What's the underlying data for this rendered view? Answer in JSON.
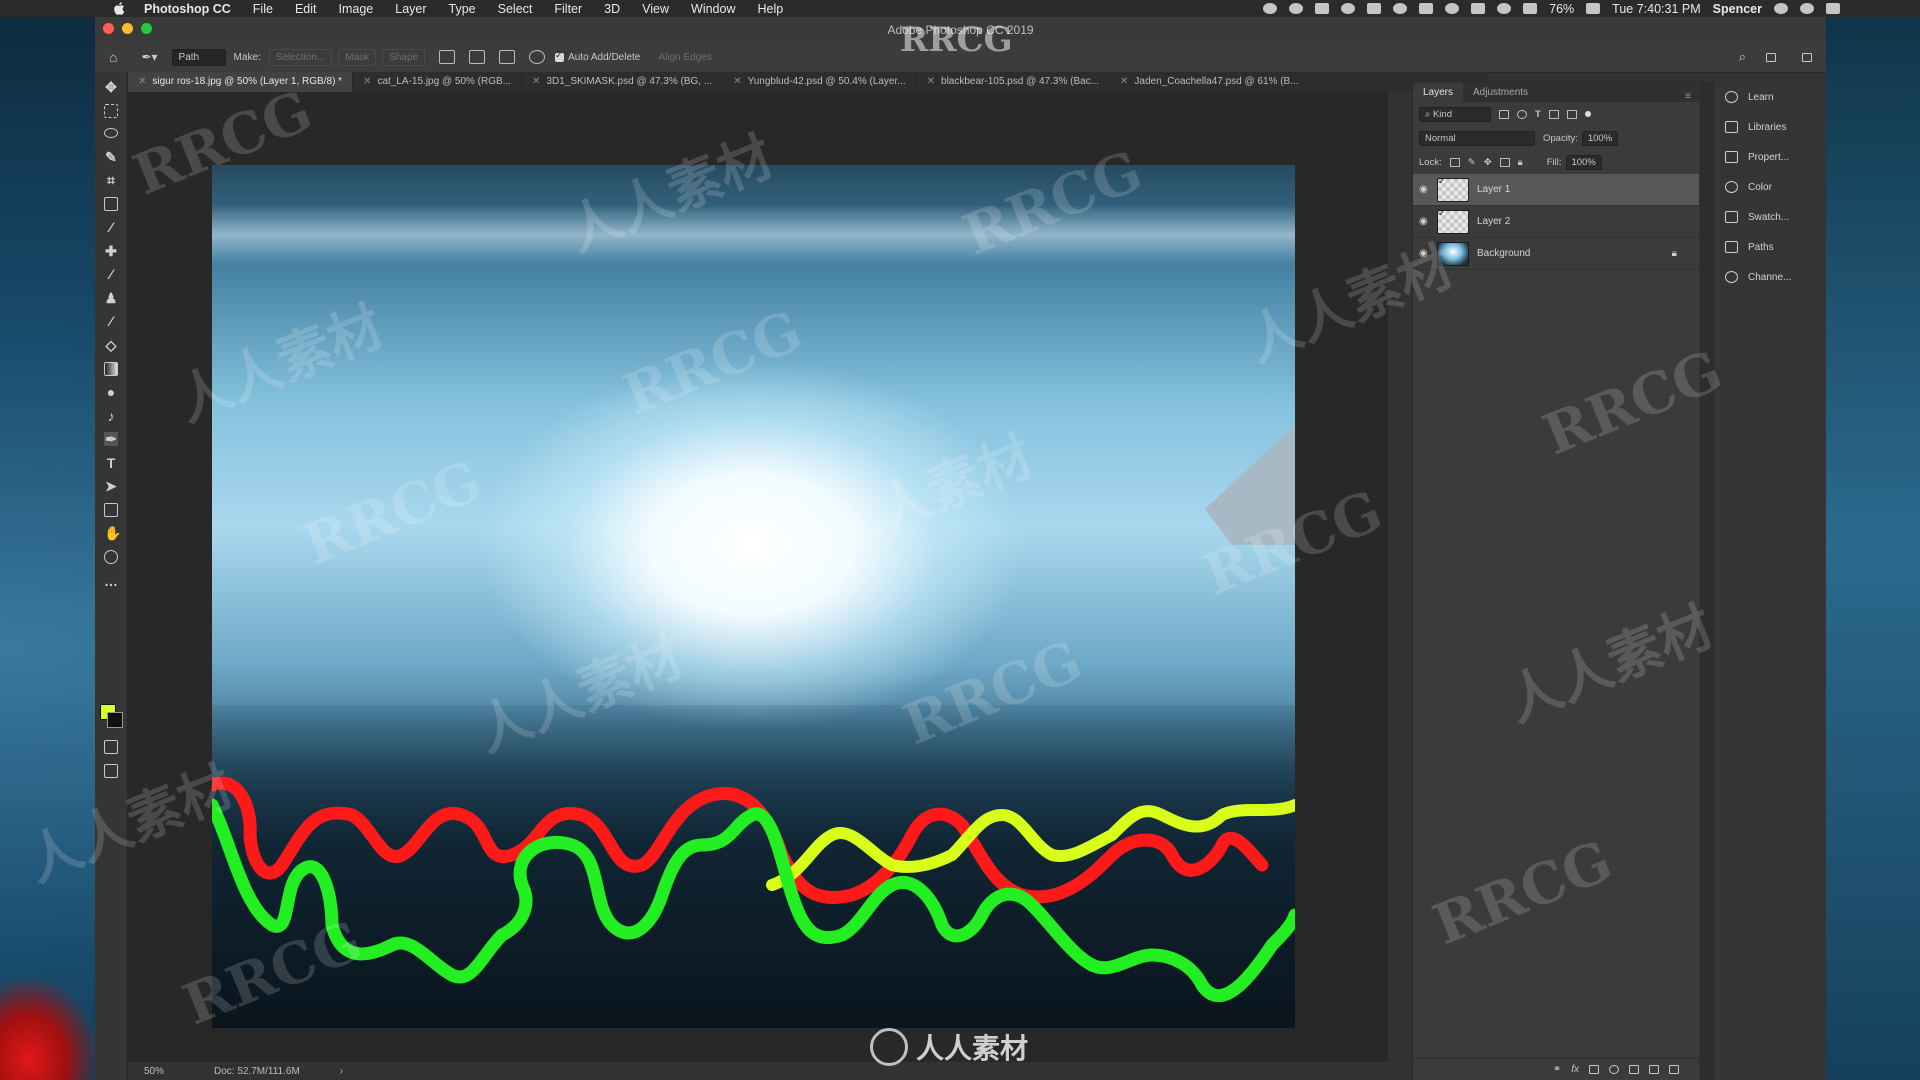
{
  "menubar": {
    "items": [
      "Photoshop CC",
      "File",
      "Edit",
      "Image",
      "Layer",
      "Type",
      "Select",
      "Filter",
      "3D",
      "View",
      "Window",
      "Help"
    ],
    "battery": "76%",
    "clock": "Tue 7:40:31 PM",
    "user": "Spencer"
  },
  "window": {
    "title": "Adobe Photoshop CC 2019"
  },
  "options": {
    "mode": "Path",
    "make_label": "Make:",
    "selection_btn": "Selection...",
    "mask_btn": "Mask",
    "shape_btn": "Shape",
    "auto_add_delete": "Auto Add/Delete",
    "align_edges": "Align Edges"
  },
  "tabs": [
    "sigur ros-18.jpg @ 50% (Layer 1, RGB/8) *",
    "cat_LA-15.jpg @ 50% (RGB...",
    "3D1_SKIMASK.psd @ 47.3% (BG, ...",
    "Yungblud-42.psd @ 50.4% (Layer...",
    "blackbear-105.psd @ 47.3% (Bac...",
    "Jaden_Coachella47.psd @ 61% (B..."
  ],
  "status": {
    "zoom": "50%",
    "doc": "Doc: 52.7M/111.6M"
  },
  "layers_panel": {
    "tabs": [
      "Layers",
      "Adjustments"
    ],
    "filter": "Kind",
    "blend_mode": "Normal",
    "opacity_label": "Opacity:",
    "opacity": "100%",
    "lock_label": "Lock:",
    "fill_label": "Fill:",
    "fill": "100%",
    "layers": [
      {
        "name": "Layer 1"
      },
      {
        "name": "Layer 2"
      },
      {
        "name": "Background"
      }
    ]
  },
  "dock": [
    "Learn",
    "Libraries",
    "Propert...",
    "Color",
    "Swatch...",
    "Paths",
    "Channe..."
  ],
  "watermark": {
    "text": "RRCG",
    "cn": "人人素材"
  },
  "colors": {
    "foreground": "#d7ff2a",
    "background": "#111111",
    "stroke_red": "#ff1a1a",
    "stroke_green": "#22ee22",
    "stroke_yellow": "#d8ff1a"
  }
}
